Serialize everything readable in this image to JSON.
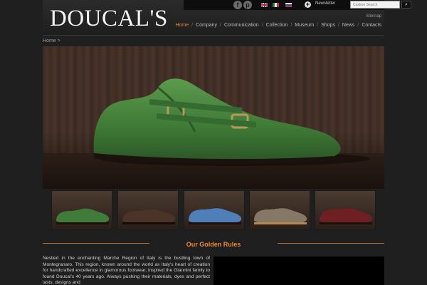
{
  "header": {
    "logo": "DOUCAL'S",
    "social": [
      "facebook-icon",
      "pinterest-icon"
    ],
    "languages": [
      "English",
      "Italiano",
      "Русский"
    ],
    "newsletter_label": "Newsletter",
    "search": {
      "placeholder": "Custom Search",
      "button_label": "⌕"
    },
    "sitemap_label": "Sitemap"
  },
  "nav": {
    "items": [
      {
        "label": "Home",
        "active": true
      },
      {
        "label": "Company"
      },
      {
        "label": "Communication"
      },
      {
        "label": "Collection"
      },
      {
        "label": "Museum"
      },
      {
        "label": "Shops"
      },
      {
        "label": "News"
      },
      {
        "label": "Contacts"
      }
    ],
    "separator": "/",
    "active_color": "#e98a2c"
  },
  "breadcrumb": "Home >",
  "hero": {
    "image": "green suede double monk strap shoe"
  },
  "thumbnails": [
    {
      "name": "green suede monk strap",
      "color": "#3f7b3a"
    },
    {
      "name": "brown leather loafer",
      "color": "#4a3428"
    },
    {
      "name": "blue suede oxford",
      "color": "#4f7fb8"
    },
    {
      "name": "grey suede brogue",
      "color": "#857866"
    },
    {
      "name": "burgundy leather brogue",
      "color": "#6e1f22"
    }
  ],
  "section": {
    "title": "Our Golden Rules"
  },
  "body_text": "Nestled in the enchanting Marche Region of Italy is the bustling town of Montegranaro. This region, known around the world as Italy's heart of creation for handcrafted excellence in glamorous footwear, inspired the Giannini family to found Doucal's 40 years ago. Always pushing their materials, dyes and perfect lasts, designs and"
}
